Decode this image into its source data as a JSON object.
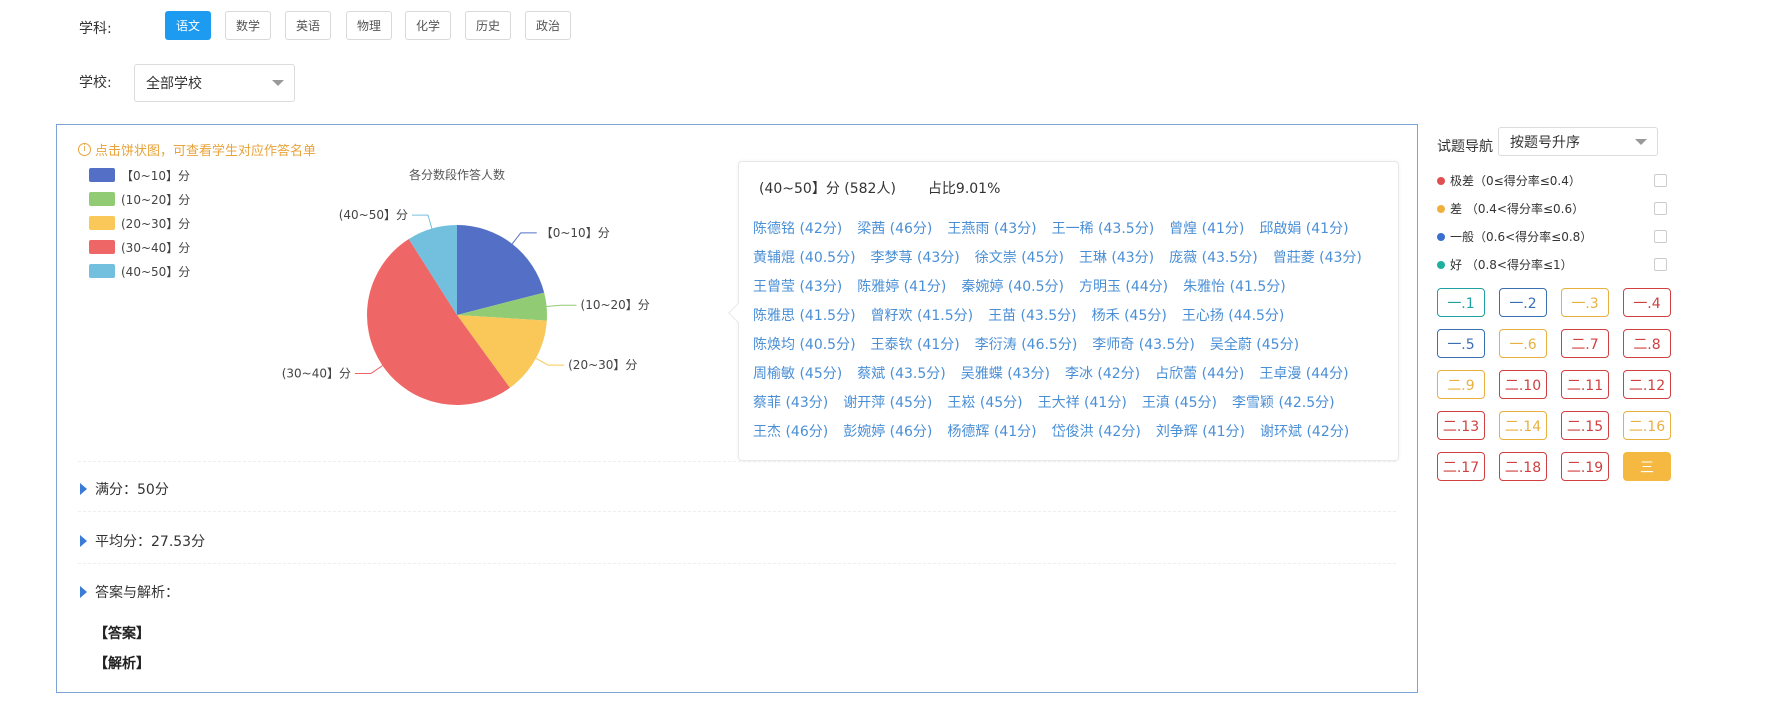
{
  "filters": {
    "subject_label": "学科:",
    "subjects": [
      "语文",
      "数学",
      "英语",
      "物理",
      "化学",
      "历史",
      "政治"
    ],
    "active_subject_index": 0,
    "school_label": "学校:",
    "school_selected": "全部学校"
  },
  "chart_data": {
    "type": "pie",
    "title": "各分数段作答人数",
    "hint": "点击饼状图，可查看学生对应作答名单",
    "hint_icon": "info-icon",
    "categories": [
      "【0~10】分",
      "(10~20】分",
      "(20~30】分",
      "(30~40】分",
      "(40~50】分"
    ],
    "values": [
      21,
      5,
      14,
      51,
      9
    ],
    "colors": [
      "#5470c6",
      "#91cc75",
      "#fac858",
      "#ee6666",
      "#73c0de"
    ],
    "legend_position": "top-left"
  },
  "detail": {
    "range_label": "(40~50】分 (582人)",
    "ratio_label": "占比9.01%",
    "names": [
      "陈德铭 (42分)",
      "梁茜 (46分)",
      "王燕雨 (43分)",
      "王一稀 (43.5分)",
      "曾煌 (41分)",
      "邱啟娟 (41分)",
      "黄辅焜 (40.5分)",
      "李梦荨 (43分)",
      "徐文崇 (45分)",
      "王琳 (43分)",
      "庞薇 (43.5分)",
      "曾莊菱 (43分)",
      "王曾莹 (43分)",
      "陈雅婷 (41分)",
      "秦婉婷 (40.5分)",
      "方明玉 (44分)",
      "朱雅怡 (41.5分)",
      "陈雅思 (41.5分)",
      "曾籽欢 (41.5分)",
      "王苗 (43.5分)",
      "杨禾 (45分)",
      "王心扬 (44.5分)",
      "陈焕均 (40.5分)",
      "王泰钦 (41分)",
      "李衍涛 (46.5分)",
      "李师奇 (43.5分)",
      "吴全蔚 (45分)",
      "周榆敏 (45分)",
      "蔡斌 (43.5分)",
      "吴雅蝶 (43分)",
      "李冰 (42分)",
      "占欣蕾 (44分)",
      "王卓漫 (44分)",
      "蔡菲 (43分)",
      "谢开萍 (45分)",
      "王崧 (45分)",
      "王大祥 (41分)",
      "王滇 (45分)",
      "李雪颖 (42.5分)",
      "王杰 (46分)",
      "彭婉婷 (46分)",
      "杨德辉 (41分)",
      "岱俊洪 (42分)",
      "刘争辉 (41分)",
      "谢环斌 (42分)"
    ]
  },
  "sections": {
    "full_score": "满分：50分",
    "average": "平均分：27.53分",
    "analysis": "答案与解析：",
    "answer": "【答案】",
    "explanation": "【解析】"
  },
  "sidebar": {
    "nav_label": "试题导航",
    "sort_selected": "按题号升序",
    "filters": [
      {
        "label": "极差（0≤得分率≤0.4）",
        "color": "#e05050"
      },
      {
        "label": "差 （0.4<得分率≤0.6）",
        "color": "#f0b040"
      },
      {
        "label": "一般（0.6<得分率≤0.8）",
        "color": "#3a6fd0"
      },
      {
        "label": "好 （0.8<得分率≤1）",
        "color": "#20b0a0"
      }
    ],
    "questions": [
      {
        "label": "一.1",
        "color": "#20a0a0"
      },
      {
        "label": "一.2",
        "color": "#3a6fb0"
      },
      {
        "label": "一.3",
        "color": "#e8b040"
      },
      {
        "label": "一.4",
        "color": "#d04040"
      },
      {
        "label": "一.5",
        "color": "#3a6fb0"
      },
      {
        "label": "一.6",
        "color": "#e8b040"
      },
      {
        "label": "二.7",
        "color": "#d04040"
      },
      {
        "label": "二.8",
        "color": "#d04040"
      },
      {
        "label": "二.9",
        "color": "#e8b040"
      },
      {
        "label": "二.10",
        "color": "#d04040"
      },
      {
        "label": "二.11",
        "color": "#d04040"
      },
      {
        "label": "二.12",
        "color": "#d04040"
      },
      {
        "label": "二.13",
        "color": "#d04040"
      },
      {
        "label": "二.14",
        "color": "#e8b040"
      },
      {
        "label": "二.15",
        "color": "#d04040"
      },
      {
        "label": "二.16",
        "color": "#e8b040"
      },
      {
        "label": "二.17",
        "color": "#d04040"
      },
      {
        "label": "二.18",
        "color": "#d04040"
      },
      {
        "label": "二.19",
        "color": "#d04040"
      },
      {
        "label": "三",
        "color": "#f5b840",
        "filled": true
      }
    ]
  }
}
